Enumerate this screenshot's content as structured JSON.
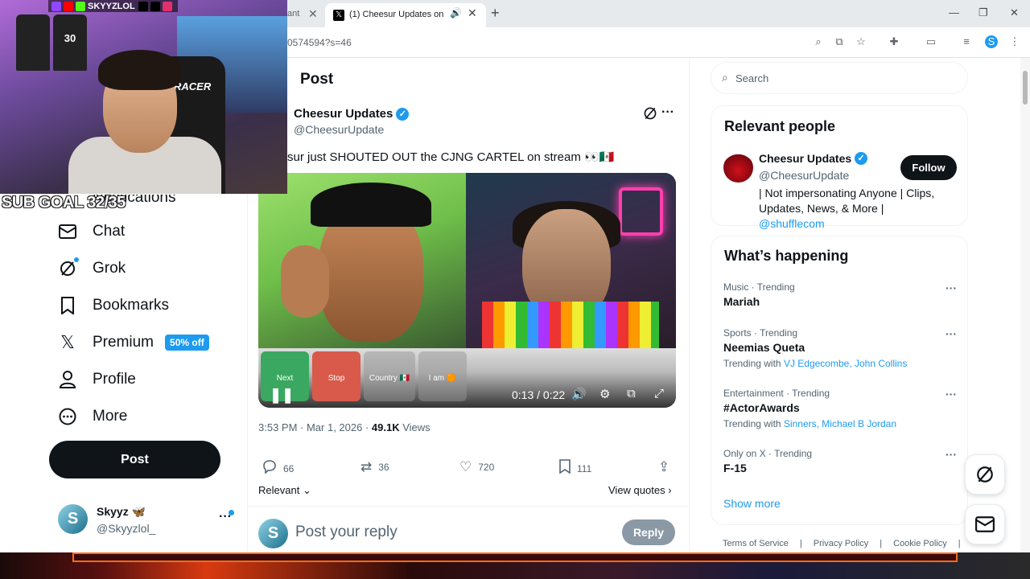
{
  "browser": {
    "prev_tab_fragment": "ant",
    "active_tab_title": "(1) Cheesur Updates on X: \"",
    "url_fragment": "0574594?s=46"
  },
  "stream_overlay": {
    "socials_handle": "SKYYZLOL",
    "sub_goal": "SUB GOAL 32/35",
    "chair_text": "RACER",
    "jersey_number": "30"
  },
  "nav": {
    "partial_item": "Notifications",
    "items": [
      {
        "label": "Chat",
        "icon": "mail-icon"
      },
      {
        "label": "Grok",
        "icon": "grok-icon"
      },
      {
        "label": "Bookmarks",
        "icon": "bookmark-icon"
      },
      {
        "label": "Premium",
        "icon": "x-logo-icon",
        "badge": "50% off"
      },
      {
        "label": "Profile",
        "icon": "person-icon"
      },
      {
        "label": "More",
        "icon": "more-circle-icon"
      }
    ],
    "post_button": "Post",
    "account": {
      "name": "Skyyz 🦋",
      "handle": "@Skyyzlol_",
      "avatar_letter": "S"
    }
  },
  "post": {
    "page_title": "Post",
    "author_name": "Cheesur Updates",
    "author_handle": "@CheesurUpdate",
    "text": "sur just SHOUTED OUT the CJNG CARTEL on stream 👀🇲🇽",
    "video": {
      "time": "0:13 / 0:22",
      "buttons": [
        {
          "label": "Next",
          "color": "#3aa860"
        },
        {
          "label": "Stop",
          "color": "#d95a4a"
        },
        {
          "label": "Country 🇲🇽",
          "color": "#a8a8a8"
        },
        {
          "label": "I am 🟠",
          "color": "#a8a8a8"
        }
      ]
    },
    "meta_time": "3:53 PM · Mar 1, 2026 · ",
    "views_count": "49.1K",
    "views_label": " Views",
    "stats": {
      "replies": "66",
      "reposts": "36",
      "likes": "720",
      "bookmarks": "111"
    },
    "sort_label": "Relevant",
    "view_quotes": "View quotes",
    "reply_placeholder": "Post your reply",
    "reply_button": "Reply"
  },
  "sidebar": {
    "search_placeholder": "Search",
    "relevant_people_title": "Relevant people",
    "person": {
      "name": "Cheesur Updates",
      "handle": "@CheesurUpdate",
      "bio": "| Not impersonating Anyone | Clips, Updates, News, & More | ",
      "bio_link": "@shufflecom",
      "follow_label": "Follow"
    },
    "happening_title": "What’s happening",
    "trends": [
      {
        "context": "Music · Trending",
        "name": "Mariah",
        "with_label": "",
        "with_links": ""
      },
      {
        "context": "Sports · Trending",
        "name": "Neemias Queta",
        "with_label": "Trending with ",
        "with_links": "VJ Edgecombe, John Collins"
      },
      {
        "context": "Entertainment · Trending",
        "name": "#ActorAwards",
        "with_label": "Trending with ",
        "with_links": "Sinners, Michael B Jordan"
      },
      {
        "context": "Only on X · Trending",
        "name": "F-15",
        "with_label": "",
        "with_links": ""
      }
    ],
    "show_more": "Show more",
    "footer": [
      "Terms of Service",
      "|",
      "Privacy Policy",
      "|",
      "Cookie Policy",
      "|"
    ]
  },
  "colors": {
    "accent": "#1d9bf0",
    "text": "#0f1419",
    "muted": "#536471"
  }
}
